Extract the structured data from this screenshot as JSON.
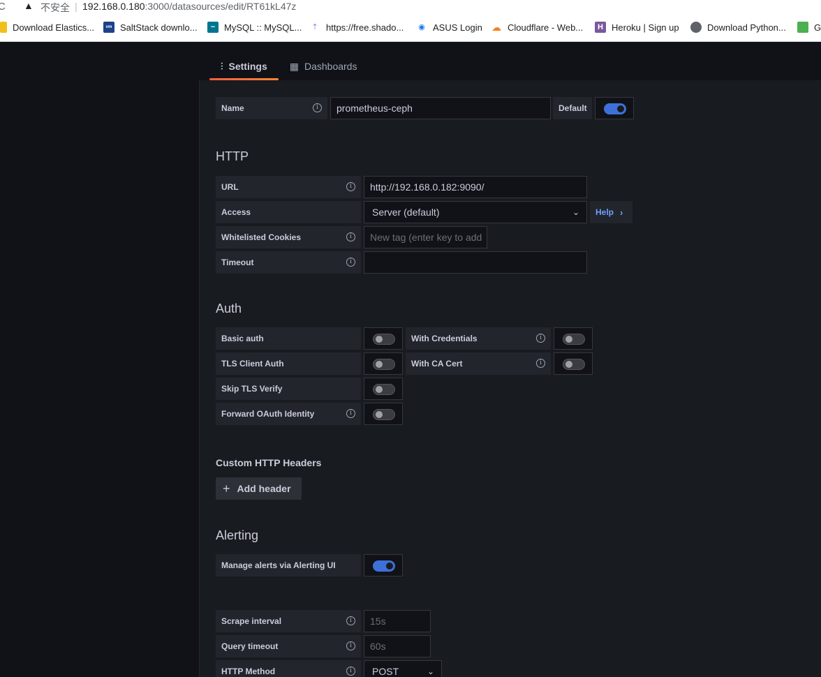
{
  "browser": {
    "insecure_label": "不安全",
    "url_host": "192.168.0.180",
    "url_path": ":3000/datasources/edit/RT61kL47z",
    "bookmarks": [
      {
        "label": "Download Elastics...",
        "icon": "elastic-icon",
        "color": "#f0bf1a"
      },
      {
        "label": "SaltStack downlo...",
        "icon": "vmware-icon",
        "color": "#1d428a"
      },
      {
        "label": "MySQL :: MySQL...",
        "icon": "mysql-icon",
        "color": "#00758f"
      },
      {
        "label": "https://free.shado...",
        "icon": "rocket-icon",
        "color": "#8ea1e1"
      },
      {
        "label": "ASUS Login",
        "icon": "wifi-icon",
        "color": "#1a73e8"
      },
      {
        "label": "Cloudflare - Web...",
        "icon": "cloudflare-icon",
        "color": "#f38020"
      },
      {
        "label": "Heroku | Sign up",
        "icon": "heroku-icon",
        "color": "#79589f"
      },
      {
        "label": "Download Python...",
        "icon": "globe-icon",
        "color": "#5f6368"
      },
      {
        "label": "G",
        "icon": "g-icon",
        "color": "#4caf50"
      }
    ]
  },
  "tabs": [
    {
      "label": "Settings",
      "icon": "sliders-icon",
      "active": true
    },
    {
      "label": "Dashboards",
      "icon": "grid-icon",
      "active": false
    }
  ],
  "name_row": {
    "label": "Name",
    "value": "prometheus-ceph",
    "default_label": "Default",
    "default_on": true
  },
  "http": {
    "title": "HTTP",
    "url_label": "URL",
    "url_value": "http://192.168.0.182:9090/",
    "access_label": "Access",
    "access_value": "Server (default)",
    "help_label": "Help",
    "cookies_label": "Whitelisted Cookies",
    "cookies_placeholder": "New tag (enter key to add",
    "timeout_label": "Timeout",
    "timeout_value": ""
  },
  "auth": {
    "title": "Auth",
    "basic_auth": "Basic auth",
    "with_credentials": "With Credentials",
    "tls_client_auth": "TLS Client Auth",
    "with_ca_cert": "With CA Cert",
    "skip_tls_verify": "Skip TLS Verify",
    "forward_oauth": "Forward OAuth Identity"
  },
  "custom_headers": {
    "title": "Custom HTTP Headers",
    "add_label": "Add header"
  },
  "alerting": {
    "title": "Alerting",
    "manage_label": "Manage alerts via Alerting UI",
    "manage_on": true
  },
  "prometheus": {
    "scrape_label": "Scrape interval",
    "scrape_placeholder": "15s",
    "query_timeout_label": "Query timeout",
    "query_timeout_placeholder": "60s",
    "http_method_label": "HTTP Method",
    "http_method_value": "POST"
  }
}
